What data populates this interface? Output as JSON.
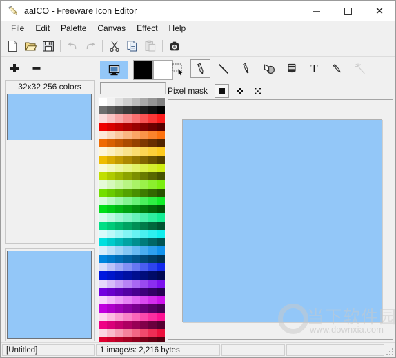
{
  "window": {
    "title": "aaICO - Freeware Icon Editor",
    "icon": "pencil-icon",
    "minimize_label": "–",
    "maximize_label": "□",
    "close_label": "✕"
  },
  "menubar": {
    "items": [
      {
        "label": "File"
      },
      {
        "label": "Edit"
      },
      {
        "label": "Palette"
      },
      {
        "label": "Canvas"
      },
      {
        "label": "Effect"
      },
      {
        "label": "Help"
      }
    ]
  },
  "toolbar": {
    "buttons": [
      {
        "name": "new-file-button",
        "icon": "new-document-icon",
        "enabled": true
      },
      {
        "name": "open-file-button",
        "icon": "open-folder-icon",
        "enabled": true
      },
      {
        "name": "save-file-button",
        "icon": "floppy-disk-icon",
        "enabled": true
      },
      {
        "name": "undo-button",
        "icon": "undo-arrow-icon",
        "enabled": false
      },
      {
        "name": "redo-button",
        "icon": "redo-arrow-icon",
        "enabled": false
      },
      {
        "name": "cut-button",
        "icon": "scissors-icon",
        "enabled": true
      },
      {
        "name": "copy-button",
        "icon": "copy-pages-icon",
        "enabled": true
      },
      {
        "name": "paste-button",
        "icon": "paste-clipboard-icon",
        "enabled": false
      },
      {
        "name": "capture-button",
        "icon": "camera-icon",
        "enabled": true
      }
    ]
  },
  "left_panel": {
    "zoom_in_label": "+",
    "zoom_out_label": "−",
    "preview_top": {
      "label": "32x32 256 colors",
      "image_color": "#93c7f8"
    },
    "preview_bottom": {
      "image_color": "#93c7f8"
    }
  },
  "palette_panel": {
    "mode_swatch": {
      "name": "image-format-swatch",
      "icon": "monitor-icon",
      "color": "#93c7f8"
    },
    "foreground_color": "#000000",
    "background_color": "#ffffff",
    "custom_colors_label": "",
    "colors": [
      "#ffffff",
      "#f2f2f2",
      "#e0e0e0",
      "#cfcfcf",
      "#bcbcbc",
      "#a8a8a8",
      "#949494",
      "#808080",
      "#6e6e6e",
      "#5c5c5c",
      "#4a4a4a",
      "#3a3a3a",
      "#2c2c2c",
      "#1e1e1e",
      "#101010",
      "#000000",
      "#fbdcdc",
      "#f9c3c3",
      "#f8a8a8",
      "#f78d8d",
      "#f87070",
      "#f85454",
      "#fa3737",
      "#fb1c1c",
      "#ef0000",
      "#d90000",
      "#c40000",
      "#ae0000",
      "#990000",
      "#830000",
      "#6d0000",
      "#570000",
      "#fde8d8",
      "#fcd8bc",
      "#fbc79f",
      "#fab682",
      "#fba566",
      "#fb9449",
      "#fc832c",
      "#fd7210",
      "#ef6a00",
      "#d86000",
      "#c25600",
      "#ab4c00",
      "#954200",
      "#7e3800",
      "#682e00",
      "#512400",
      "#fdf6db",
      "#fcf0c1",
      "#fbe9a6",
      "#fae38b",
      "#fbdd70",
      "#fbd655",
      "#fcd03a",
      "#fdca1f",
      "#efbd00",
      "#d9ab00",
      "#c39a00",
      "#ad8800",
      "#977700",
      "#816500",
      "#6b5400",
      "#554200",
      "#f8fbd8",
      "#f2f9bc",
      "#ecf79f",
      "#e6f583",
      "#e1f367",
      "#dbf14a",
      "#d5ef2e",
      "#cfed12",
      "#c1df00",
      "#afcb00",
      "#9eb700",
      "#8ca300",
      "#7b8f00",
      "#697b00",
      "#586700",
      "#465300",
      "#e5fbd8",
      "#d6f9bc",
      "#c7f79f",
      "#b8f583",
      "#a9f367",
      "#9af14a",
      "#8bef2e",
      "#7ced12",
      "#73df00",
      "#69cb00",
      "#5eb700",
      "#53a300",
      "#488f00",
      "#3d7b00",
      "#326700",
      "#275300",
      "#d8fbdd",
      "#bcf9c3",
      "#9ff7aa",
      "#83f590",
      "#67f377",
      "#4af15d",
      "#2eef44",
      "#12ed2a",
      "#00df18",
      "#00cb16",
      "#00b713",
      "#00a311",
      "#008f0f",
      "#007b0d",
      "#00670b",
      "#005308",
      "#d8fbee",
      "#bcf9e1",
      "#9ff7d4",
      "#83f5c7",
      "#67f3ba",
      "#4af1ad",
      "#2eefa0",
      "#12ed93",
      "#00df85",
      "#00cb79",
      "#00b76d",
      "#00a361",
      "#008f55",
      "#007b49",
      "#00673d",
      "#005331",
      "#d8fbfb",
      "#bcf9f9",
      "#9ff7f7",
      "#83f5f5",
      "#67f3f3",
      "#4af1f1",
      "#2eefef",
      "#12eded",
      "#00dfdf",
      "#00cbcb",
      "#00b7b7",
      "#00a3a3",
      "#008f8f",
      "#007b7b",
      "#006767",
      "#005353",
      "#d8eefb",
      "#bce1f9",
      "#9fd4f7",
      "#83c7f5",
      "#67baf3",
      "#4aadf1",
      "#2ea0ef",
      "#1293ed",
      "#0085df",
      "#0079cb",
      "#006db7",
      "#0061a3",
      "#00558f",
      "#00497b",
      "#003d67",
      "#003153",
      "#d8ddfb",
      "#bcc3f9",
      "#9faaf7",
      "#8390f5",
      "#6777f3",
      "#4a5df1",
      "#2e44ef",
      "#122aed",
      "#0018df",
      "#0016cb",
      "#0013b7",
      "#0011a3",
      "#000f8f",
      "#000d7b",
      "#000b67",
      "#000853",
      "#e5d8fb",
      "#d6bcf9",
      "#c79ff7",
      "#b883f5",
      "#a967f3",
      "#9a4af1",
      "#8b2eef",
      "#7c12ed",
      "#7300df",
      "#6900cb",
      "#5e00b7",
      "#5300a3",
      "#48008f",
      "#3d007b",
      "#320067",
      "#270053",
      "#f8d8fb",
      "#f2bcf9",
      "#ec9ff7",
      "#e683f5",
      "#e167f3",
      "#db4af1",
      "#d52eef",
      "#cf12ed",
      "#c100df",
      "#af00cb",
      "#9e00b7",
      "#8c00a3",
      "#7b008f",
      "#69007b",
      "#580067",
      "#460053",
      "#fdd8ef",
      "#fcbce1",
      "#fb9fd4",
      "#fa83c7",
      "#fb67ba",
      "#fb4aad",
      "#fc2ea0",
      "#fd1293",
      "#ef0085",
      "#d90079",
      "#c3006d",
      "#ad0061",
      "#970055",
      "#810049",
      "#6b003d",
      "#550031",
      "#fbd8e3",
      "#f9bccb",
      "#f79fb4",
      "#f5839c",
      "#f36785",
      "#f14a6d",
      "#ef2e56",
      "#ed123e",
      "#df0030",
      "#cb002b",
      "#b70027",
      "#a30022",
      "#8f001e",
      "#7b001a",
      "#670016",
      "#530011"
    ]
  },
  "tools": {
    "items": [
      {
        "name": "select-tool",
        "icon": "marquee-select-icon",
        "active": false,
        "enabled": true
      },
      {
        "name": "pencil-tool",
        "icon": "pencil-icon",
        "active": true,
        "enabled": true
      },
      {
        "name": "line-tool",
        "icon": "line-icon",
        "active": false,
        "enabled": true
      },
      {
        "name": "brush-tool",
        "icon": "paintbrush-icon",
        "active": false,
        "enabled": true
      },
      {
        "name": "shape-tool",
        "icon": "shapes-icon",
        "active": false,
        "enabled": true
      },
      {
        "name": "fill-tool",
        "icon": "paint-bucket-icon",
        "active": false,
        "enabled": true
      },
      {
        "name": "text-tool",
        "icon": "text-t-icon",
        "active": false,
        "enabled": true
      },
      {
        "name": "eyedropper-tool",
        "icon": "eyedropper-icon",
        "active": false,
        "enabled": true
      },
      {
        "name": "magic-wand-tool",
        "icon": "magic-wand-icon",
        "active": false,
        "enabled": false
      }
    ]
  },
  "pixel_mask": {
    "label": "Pixel mask",
    "options": [
      {
        "name": "mask-solid",
        "icon": "solid-square-icon",
        "selected": true
      },
      {
        "name": "mask-diamond",
        "icon": "diamond-dither-icon",
        "selected": false
      },
      {
        "name": "mask-checker",
        "icon": "checker-dither-icon",
        "selected": false
      }
    ]
  },
  "canvas": {
    "image_color": "#93c7f8"
  },
  "watermark": {
    "text_cn": "当下软件园",
    "url": "www.downxia.com"
  },
  "statusbar": {
    "cells": [
      {
        "name": "status-filename",
        "text": "[Untitled]"
      },
      {
        "name": "status-image-info",
        "text": "1 image/s: 2,216 bytes"
      },
      {
        "name": "status-cell-3",
        "text": ""
      },
      {
        "name": "status-cell-4",
        "text": ""
      }
    ]
  }
}
